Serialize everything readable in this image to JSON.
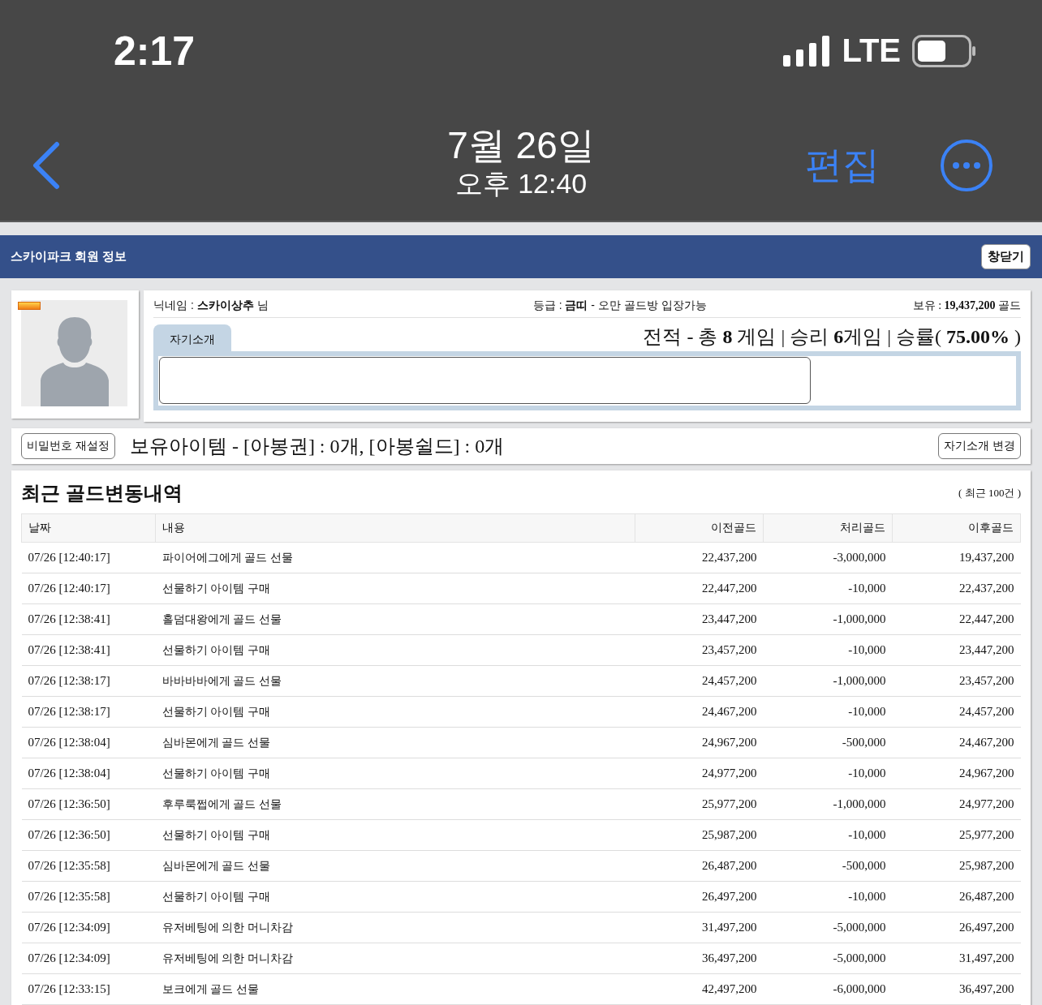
{
  "status_bar": {
    "time": "2:17",
    "network": "LTE"
  },
  "nav": {
    "date": "7월 26일",
    "time": "오후 12:40",
    "edit": "편집"
  },
  "window": {
    "title": "스카이파크 회원 정보",
    "close": "창닫기"
  },
  "profile": {
    "nickname": "닉네임 : **스카이상추** 님",
    "grade": "등급 : **금띠** - 오만 골드방 입장가능",
    "holdings": "보유 : **19,437,200** 골드",
    "intro_tab": "자기소개",
    "record": "전적 - 총 **8** 게임 | 승리 **6**게임 | 승률( **75.00%** )"
  },
  "items_bar": {
    "reset_password": "비밀번호 재설정",
    "items": "보유아이템 - [아봉권] : 0개, [아봉쉴드] : 0개",
    "change_intro": "자기소개 변경"
  },
  "history": {
    "title": "최근 골드변동내역",
    "note": "( 최근 100건 )",
    "columns": [
      "날짜",
      "내용",
      "이전골드",
      "처리골드",
      "이후골드"
    ],
    "rows": [
      [
        "07/26 [12:40:17]",
        "파이어에그에게 골드 선물",
        "22,437,200",
        "-3,000,000",
        "19,437,200"
      ],
      [
        "07/26 [12:40:17]",
        "선물하기 아이템 구매",
        "22,447,200",
        "-10,000",
        "22,437,200"
      ],
      [
        "07/26 [12:38:41]",
        "홀덤대왕에게 골드 선물",
        "23,447,200",
        "-1,000,000",
        "22,447,200"
      ],
      [
        "07/26 [12:38:41]",
        "선물하기 아이템 구매",
        "23,457,200",
        "-10,000",
        "23,447,200"
      ],
      [
        "07/26 [12:38:17]",
        "바바바바에게 골드 선물",
        "24,457,200",
        "-1,000,000",
        "23,457,200"
      ],
      [
        "07/26 [12:38:17]",
        "선물하기 아이템 구매",
        "24,467,200",
        "-10,000",
        "24,457,200"
      ],
      [
        "07/26 [12:38:04]",
        "심바몬에게 골드 선물",
        "24,967,200",
        "-500,000",
        "24,467,200"
      ],
      [
        "07/26 [12:38:04]",
        "선물하기 아이템 구매",
        "24,977,200",
        "-10,000",
        "24,967,200"
      ],
      [
        "07/26 [12:36:50]",
        "후루룩쩝에게 골드 선물",
        "25,977,200",
        "-1,000,000",
        "24,977,200"
      ],
      [
        "07/26 [12:36:50]",
        "선물하기 아이템 구매",
        "25,987,200",
        "-10,000",
        "25,977,200"
      ],
      [
        "07/26 [12:35:58]",
        "심바몬에게 골드 선물",
        "26,487,200",
        "-500,000",
        "25,987,200"
      ],
      [
        "07/26 [12:35:58]",
        "선물하기 아이템 구매",
        "26,497,200",
        "-10,000",
        "26,487,200"
      ],
      [
        "07/26 [12:34:09]",
        "유저베팅에 의한 머니차감",
        "31,497,200",
        "-5,000,000",
        "26,497,200"
      ],
      [
        "07/26 [12:34:09]",
        "유저베팅에 의한 머니차감",
        "36,497,200",
        "-5,000,000",
        "31,497,200"
      ],
      [
        "07/26 [12:33:15]",
        "보크에게 골드 선물",
        "42,497,200",
        "-6,000,000",
        "36,497,200"
      ]
    ]
  }
}
